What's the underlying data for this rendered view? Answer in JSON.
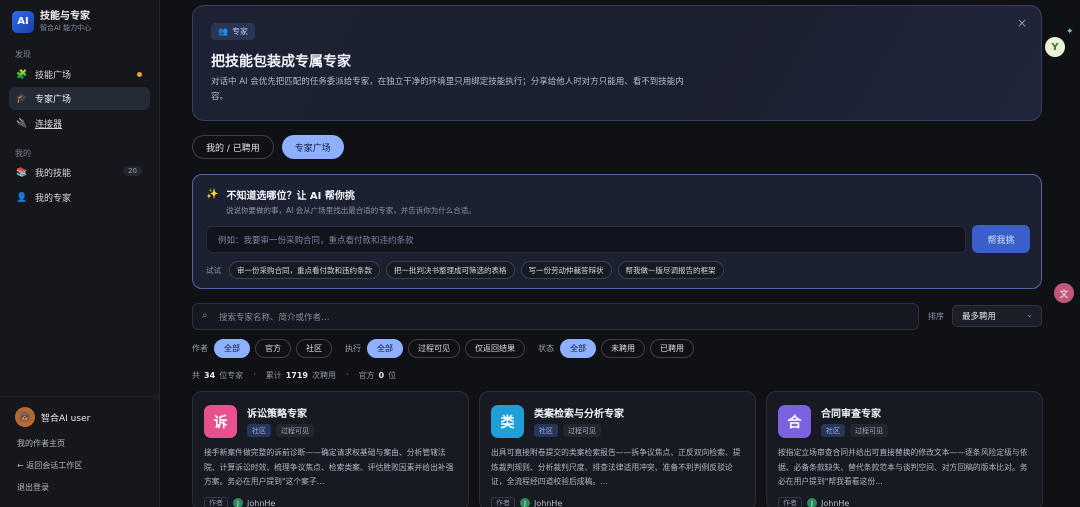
{
  "brand": {
    "logo": "AI",
    "title": "技能与专家",
    "subtitle": "智合AI 能力中心"
  },
  "sidebar": {
    "discover_label": "发现",
    "mine_label": "我的",
    "items": [
      {
        "label": "技能广场",
        "icon": "puzzle-icon"
      },
      {
        "label": "专家广场",
        "icon": "graduation-cap-icon"
      },
      {
        "label": "连接器",
        "icon": "connector-icon"
      },
      {
        "label": "我的技能",
        "icon": "books-icon",
        "count": "20"
      },
      {
        "label": "我的专家",
        "icon": "person-icon"
      }
    ],
    "user": {
      "name": "智合AI user"
    },
    "links": {
      "author_home": "我的作者主页",
      "back": "← 返回会话工作区",
      "logout": "退出登录"
    }
  },
  "banner": {
    "badge": "专家",
    "title": "把技能包装成专属专家",
    "desc": "对话中 AI 会优先把匹配的任务委派给专家，在独立干净的环境里只用绑定技能执行；分享给他人时对方只能用、看不到技能内容。",
    "close": "×"
  },
  "tabs": {
    "mine": "我的 / 已聘用",
    "plaza": "专家广场"
  },
  "helper": {
    "title": "不知道选哪位？让 AI 帮你挑",
    "subtitle": "说说你要做的事，AI 会从广场里找出最合适的专家，并告诉你为什么合适。",
    "placeholder": "例如：我要审一份采购合同，重点看付款和违约条款",
    "button": "帮我挑",
    "try_label": "试试",
    "chips": [
      "审一份采购合同，重点看付款和违约条款",
      "把一批判决书整理成可筛选的表格",
      "写一份劳动仲裁答辩状",
      "帮我做一版尽调报告的框架"
    ]
  },
  "search": {
    "placeholder": "搜索专家名称、简介或作者…",
    "sort_label": "排序",
    "sort_value": "最多聘用"
  },
  "filters": {
    "author": {
      "label": "作者",
      "options": [
        "全部",
        "官方",
        "社区"
      ]
    },
    "exec": {
      "label": "执行",
      "options": [
        "全部",
        "过程可见",
        "仅返回结果"
      ]
    },
    "status": {
      "label": "状态",
      "options": [
        "全部",
        "未聘用",
        "已聘用"
      ]
    }
  },
  "stats": {
    "total_prefix": "共",
    "total": "34",
    "total_suffix": "位专家",
    "hire_prefix": "累计",
    "hires": "1719",
    "hire_suffix": "次聘用",
    "official_prefix": "官方",
    "official": "0",
    "official_suffix": "位"
  },
  "cards": [
    {
      "icon_char": "诉",
      "color": "#e8508f",
      "title": "诉讼策略专家",
      "tags": [
        "社区",
        "过程可见"
      ],
      "desc": "接手新案件做完整的诉前诊断——确定请求权基础与案由、分析管辖法院、计算诉讼时效、梳理争议焦点、检索类案、评估胜败因素并给出补强方案。务必在用户提到\"这个案子…",
      "author_label": "作者",
      "author": "JohnHe"
    },
    {
      "icon_char": "类",
      "color": "#1f9fd6",
      "title": "类案检索与分析专家",
      "tags": [
        "社区",
        "过程可见"
      ],
      "desc": "出具可直接附卷提交的类案检索报告——拆争议焦点、正反双向检索、提炼裁判规则、分析裁判尺度、排查法律适用冲突、准备不利判例反驳论证，全流程经四道校验后成稿。…",
      "author_label": "作者",
      "author": "JohnHe"
    },
    {
      "icon_char": "合",
      "color": "#7b62e0",
      "title": "合同审查专家",
      "tags": [
        "社区",
        "过程可见"
      ],
      "desc": "按指定立场审查合同并给出可直接替换的修改文本——逐条风险定级与依据、必备条款缺失、替代条款范本与谈判空间、对方回稿的版本比对。务必在用户提到\"帮我看看这份…",
      "author_label": "作者",
      "author": "JohnHe"
    }
  ]
}
